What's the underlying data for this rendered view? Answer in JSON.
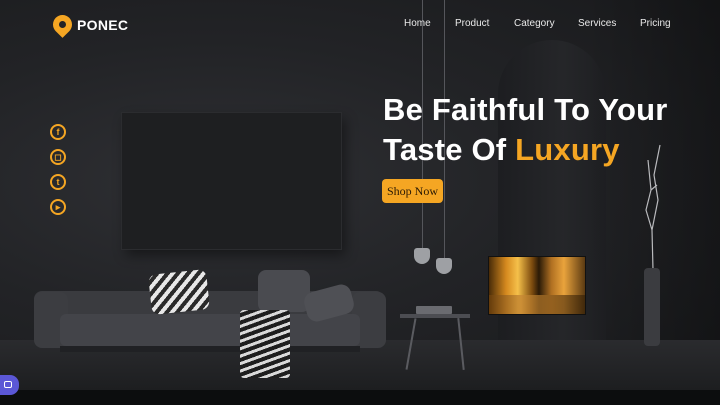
{
  "brand": {
    "name": "PONEC",
    "logo_icon": "location-pin-icon",
    "accent_color": "#f5a623"
  },
  "nav": {
    "items": [
      {
        "label": "Home"
      },
      {
        "label": "Product"
      },
      {
        "label": "Category"
      },
      {
        "label": "Services"
      },
      {
        "label": "Pricing"
      }
    ]
  },
  "social": {
    "icons": [
      "facebook-icon",
      "instagram-icon",
      "twitter-icon",
      "youtube-icon"
    ]
  },
  "hero": {
    "line1": "Be Faithful To Your",
    "line2_prefix": "Taste Of ",
    "line2_accent": "Luxury",
    "cta_label": "Shop Now"
  },
  "widget": {
    "icon": "video-camera-icon",
    "color": "#5b57d6"
  }
}
